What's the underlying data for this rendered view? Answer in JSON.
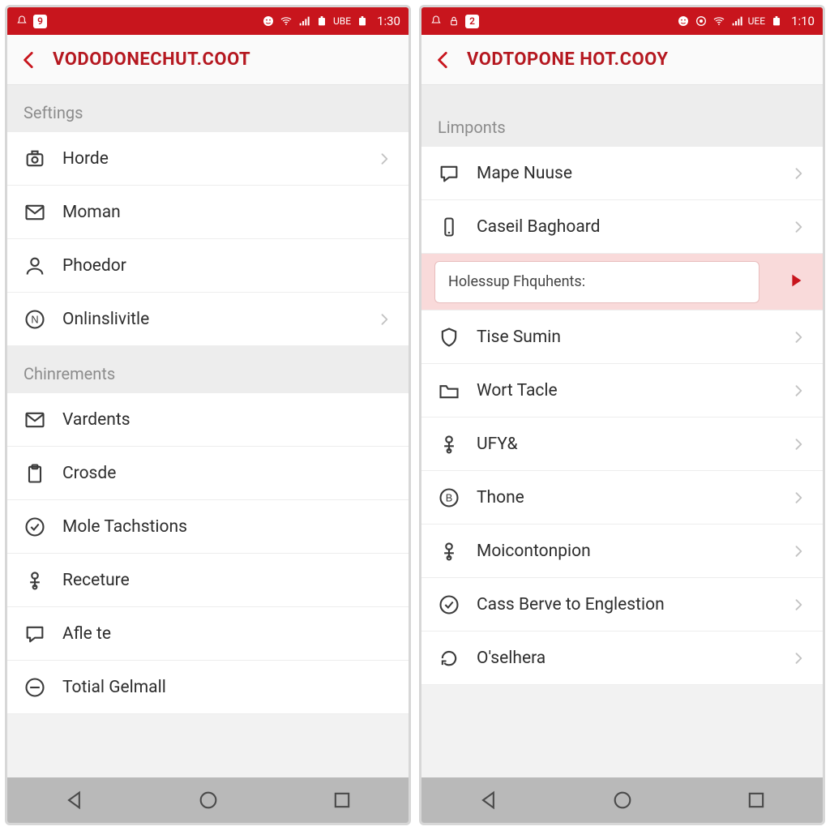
{
  "left": {
    "status": {
      "badge": "9",
      "net_label": "UBE",
      "time": "1:30"
    },
    "header": {
      "title": "VODODONECHUT.COOT"
    },
    "sections": [
      {
        "title": "Seftings",
        "items": [
          {
            "label": "Horde",
            "icon": "camera"
          },
          {
            "label": "Moman",
            "icon": "mail"
          },
          {
            "label": "Phoedor",
            "icon": "person"
          },
          {
            "label": "Onlinslivitle",
            "icon": "circle-n"
          }
        ]
      },
      {
        "title": "Chinrements",
        "items": [
          {
            "label": "Vardents",
            "icon": "mail"
          },
          {
            "label": "Crosde",
            "icon": "clipboard"
          },
          {
            "label": "Mole Tachstions",
            "icon": "check-circle"
          },
          {
            "label": "Receture",
            "icon": "person-x"
          },
          {
            "label": "Afle te",
            "icon": "chat"
          },
          {
            "label": "Totial Gelmall",
            "icon": "minus-circle"
          }
        ]
      }
    ]
  },
  "right": {
    "status": {
      "badge": "2",
      "net_label": "UEE",
      "time": "1:10"
    },
    "header": {
      "title": "VODTOPONE HOT.COOY"
    },
    "sections": [
      {
        "title": "Limponts",
        "items": [
          {
            "label": "Mape Nuuse",
            "icon": "chat"
          },
          {
            "label": "Caseil Baghoard",
            "icon": "phone"
          },
          {
            "label": "Holessup Fhquhents:",
            "highlight": true
          },
          {
            "label": "Tise Sumin",
            "icon": "shield"
          },
          {
            "label": "Wort Tacle",
            "icon": "folder"
          },
          {
            "label": "UFY&",
            "icon": "person-x"
          },
          {
            "label": "Thone",
            "icon": "circle-b"
          },
          {
            "label": "Moicontonpion",
            "icon": "person-x"
          },
          {
            "label": "Cass Berve to Englestion",
            "icon": "check-circle"
          },
          {
            "label": "O'selhera",
            "icon": "refresh"
          }
        ]
      }
    ]
  }
}
